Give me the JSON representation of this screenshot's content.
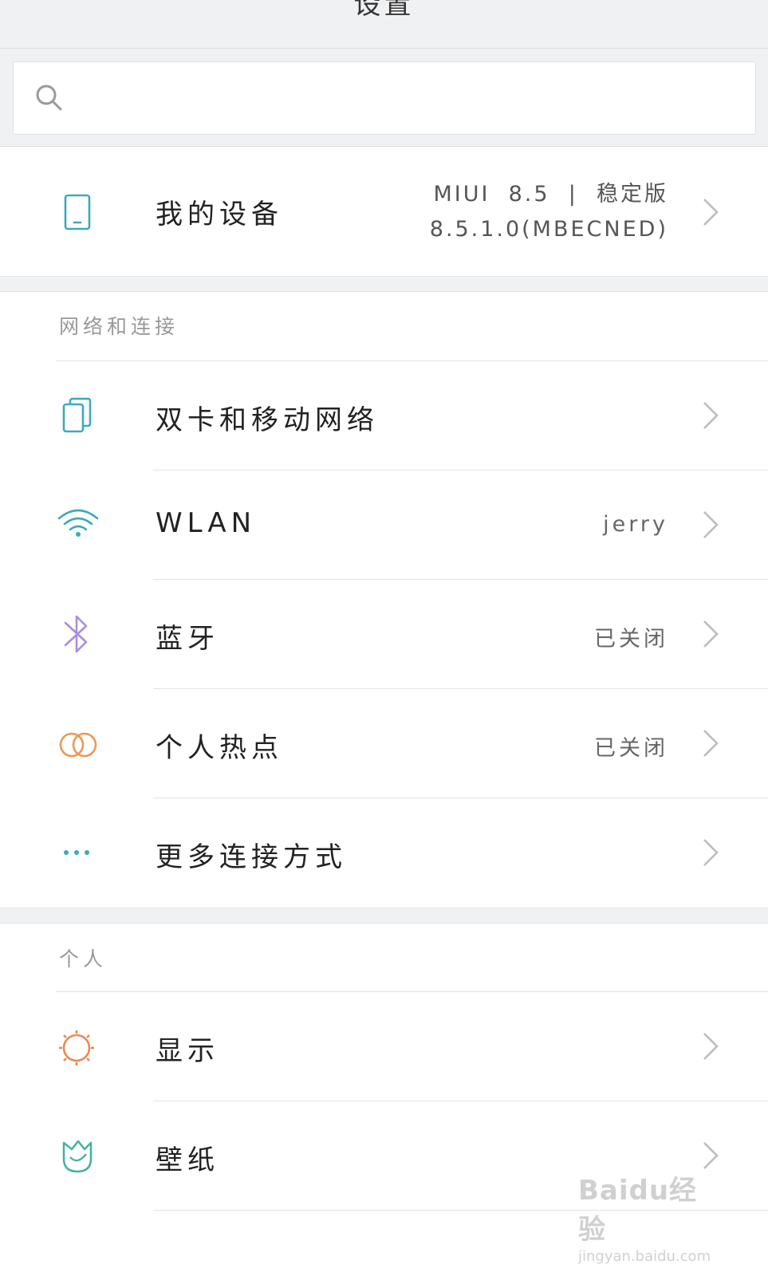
{
  "header": {
    "title": "设置"
  },
  "search": {
    "placeholder": ""
  },
  "device": {
    "label": "我的设备",
    "version_line1": "MIUI  8.5  |  稳定版",
    "version_line2": "8.5.1.0(MBECNED)"
  },
  "sections": [
    {
      "header": "网络和连接",
      "items": [
        {
          "label": "双卡和移动网络",
          "value": "",
          "icon": "dual-sim-icon"
        },
        {
          "label": "WLAN",
          "value": "jerry",
          "icon": "wifi-icon"
        },
        {
          "label": "蓝牙",
          "value": "已关闭",
          "icon": "bluetooth-icon"
        },
        {
          "label": "个人热点",
          "value": "已关闭",
          "icon": "hotspot-icon"
        },
        {
          "label": "更多连接方式",
          "value": "",
          "icon": "more-icon"
        }
      ]
    },
    {
      "header": "个人",
      "items": [
        {
          "label": "显示",
          "value": "",
          "icon": "display-icon"
        },
        {
          "label": "壁纸",
          "value": "",
          "icon": "wallpaper-icon"
        }
      ]
    }
  ],
  "watermark": {
    "brand": "Baidu经验",
    "url": "jingyan.baidu.com"
  },
  "colors": {
    "accent_teal": "#3fa9b8",
    "bluetooth_purple": "#a98fdc",
    "hotspot_orange": "#e8995a",
    "display_orange": "#e88a55",
    "wallpaper_teal": "#45b49e"
  }
}
